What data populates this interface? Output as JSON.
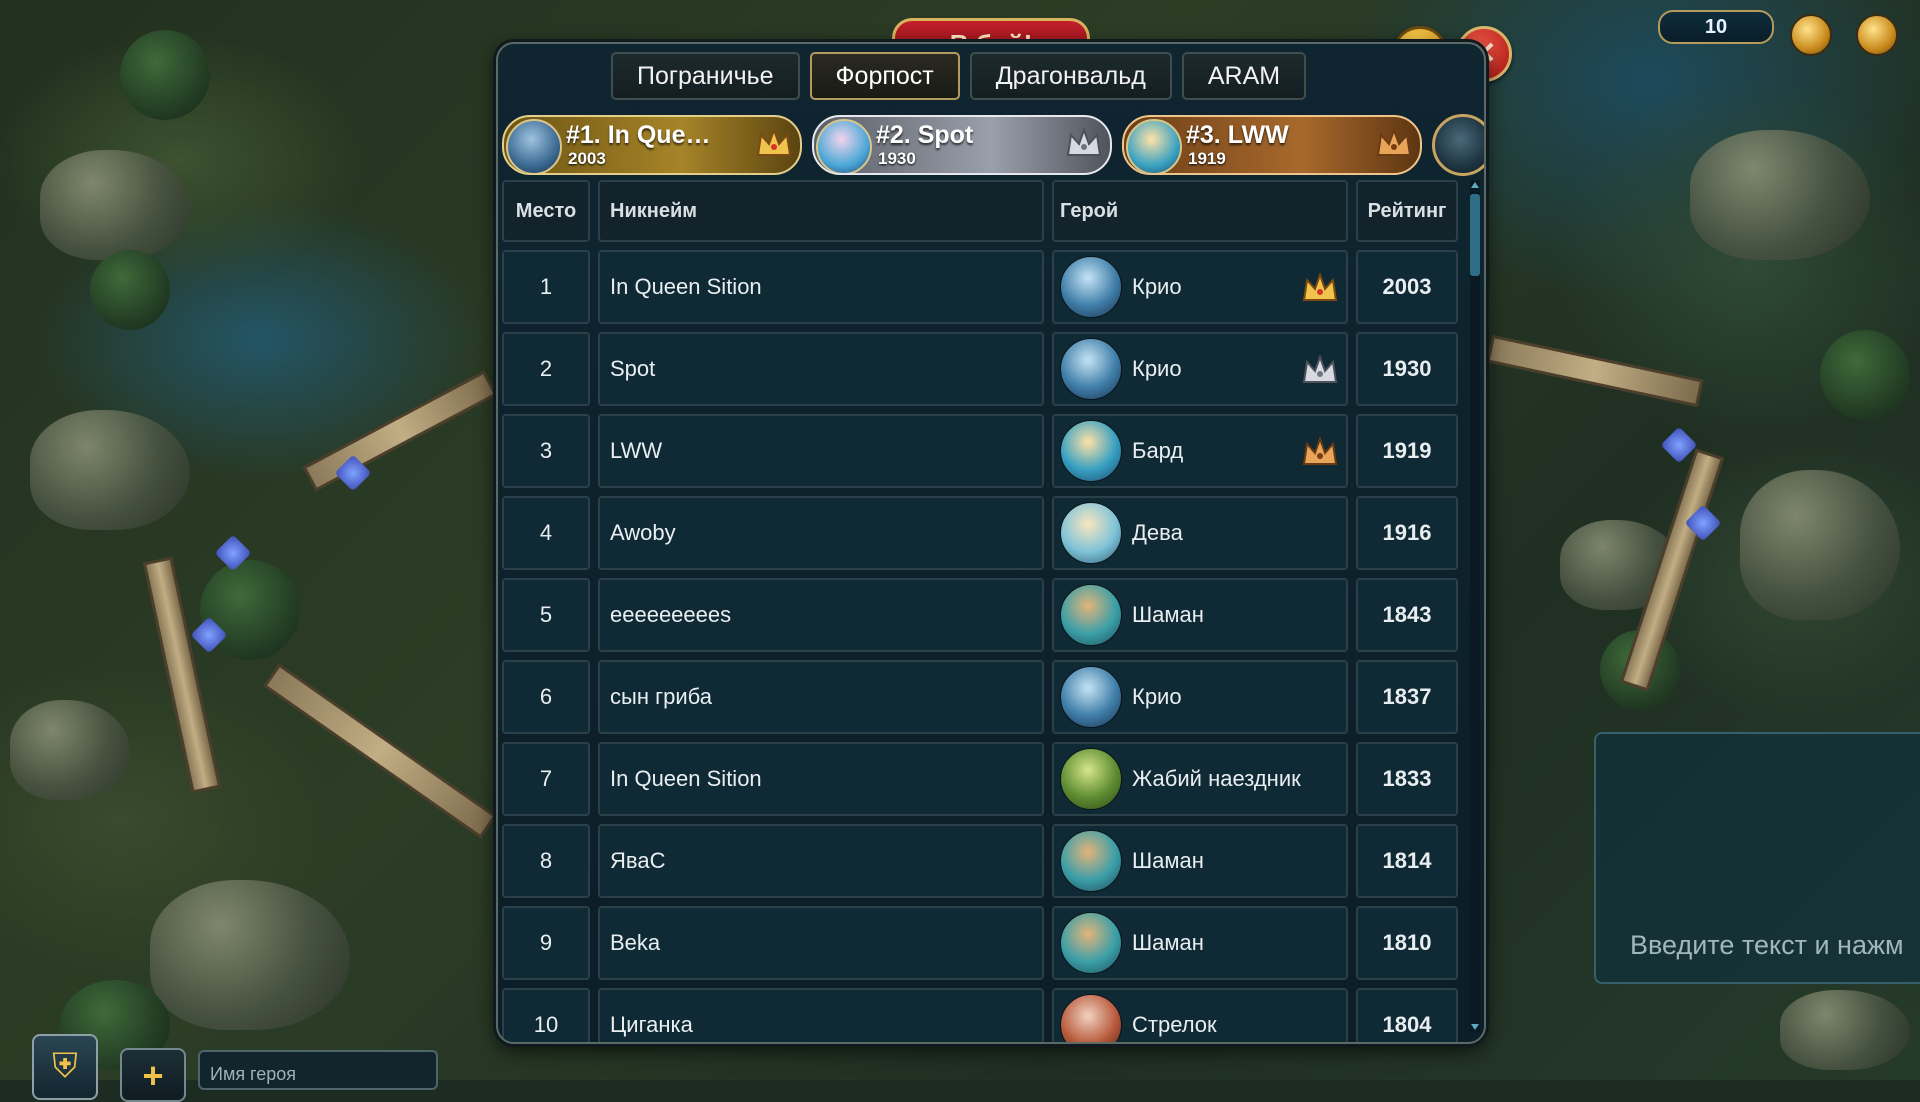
{
  "hud": {
    "battle_label": "В бой!",
    "counter": "10",
    "help_label": "?",
    "close_label": "✕"
  },
  "tabs": [
    {
      "label": "Пограничье",
      "active": false
    },
    {
      "label": "Форпост",
      "active": true
    },
    {
      "label": "Драгонвальд",
      "active": false
    },
    {
      "label": "ARAM",
      "active": false
    }
  ],
  "top3": [
    {
      "title": "#1. In Que…",
      "score": "2003",
      "tier": "gold"
    },
    {
      "title": "#2. Spot",
      "score": "1930",
      "tier": "silver"
    },
    {
      "title": "#3. LWW",
      "score": "1919",
      "tier": "bronze"
    }
  ],
  "table": {
    "headers": {
      "place": "Место",
      "nick": "Никнейм",
      "hero": "Герой",
      "rating": "Рейтинг"
    },
    "rows": [
      {
        "place": "1",
        "nick": "In Queen Sition",
        "hero": "Крио",
        "rating": "2003",
        "crown": "gold"
      },
      {
        "place": "2",
        "nick": "Spot",
        "hero": "Крио",
        "rating": "1930",
        "crown": "silver"
      },
      {
        "place": "3",
        "nick": "LWW",
        "hero": "Бард",
        "rating": "1919",
        "crown": "bronze"
      },
      {
        "place": "4",
        "nick": "Awoby",
        "hero": "Дева",
        "rating": "1916"
      },
      {
        "place": "5",
        "nick": "eeeeeeeees",
        "hero": "Шаман",
        "rating": "1843"
      },
      {
        "place": "6",
        "nick": "сын гриба",
        "hero": "Крио",
        "rating": "1837"
      },
      {
        "place": "7",
        "nick": "In Queen Sition",
        "hero": "Жабий наездник",
        "rating": "1833"
      },
      {
        "place": "8",
        "nick": "ЯваС",
        "hero": "Шаман",
        "rating": "1814"
      },
      {
        "place": "9",
        "nick": "Beka",
        "hero": "Шаман",
        "rating": "1810"
      },
      {
        "place": "10",
        "nick": "Циганка",
        "hero": "Стрелок",
        "rating": "1804"
      }
    ]
  },
  "chat": {
    "placeholder": "Введите текст и нажм"
  },
  "bottom": {
    "hero_name_placeholder": "Имя героя",
    "add_label": "+"
  },
  "colors": {
    "gold": "#d9a43a",
    "silver": "#c9ccd3",
    "bronze": "#d89a52",
    "accent_border": "#b49a5d"
  }
}
